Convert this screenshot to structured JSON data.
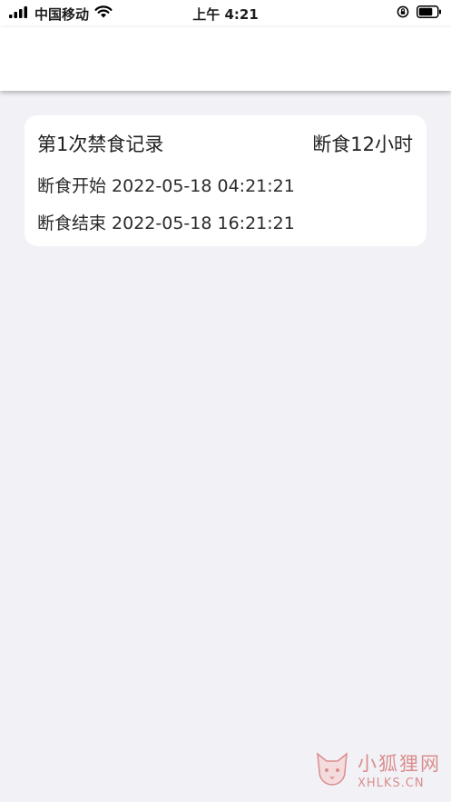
{
  "status_bar": {
    "carrier": "中国移动",
    "time": "上午 4:21",
    "icons": [
      "signal-icon",
      "wifi-icon",
      "rotation-lock-icon",
      "battery-icon"
    ]
  },
  "record": {
    "title": "第1次禁食记录",
    "duration": "断食12小时",
    "start": "断食开始 2022-05-18 04:21:21",
    "end": "断食结束 2022-05-18 16:21:21"
  },
  "watermark": {
    "name": "小狐狸网",
    "domain": "XHLKS.CN"
  },
  "colors": {
    "background": "#f2f2f6",
    "card": "#ffffff",
    "watermark": "#c73a3a"
  }
}
